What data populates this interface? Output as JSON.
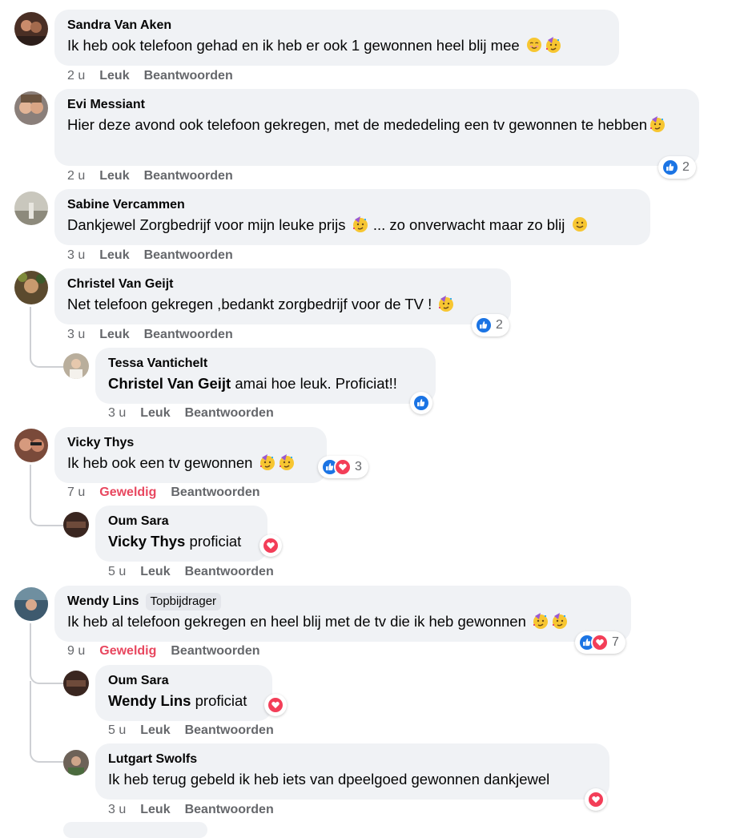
{
  "comments": [
    {
      "name": "Sandra Van Aken",
      "text": "Ik heb ook telefoon gehad en ik heb er ook 1 gewonnen heel blij mee",
      "time": "2 u",
      "action": "Leuk",
      "reply": "Beantwoorden",
      "avatar_color": "#5a3b2e"
    },
    {
      "name": "Evi Messiant",
      "text": "Hier deze avond ook telefoon gekregen, met de mededeling een tv gewonnen te hebben",
      "time": "2 u",
      "action": "Leuk",
      "reply": "Beantwoorden",
      "reaction_count": "2",
      "avatar_color": "#8a7f7a"
    },
    {
      "name": "Sabine Vercammen",
      "text": "Dankjewel Zorgbedrijf voor mijn leuke prijs",
      "text2": "... zo onverwacht maar zo blij",
      "time": "3 u",
      "action": "Leuk",
      "reply": "Beantwoorden",
      "avatar_color": "#b8b4a6"
    },
    {
      "name": "Christel Van Geijt",
      "text": "Net telefoon gekregen ,bedankt zorgbedrijf voor de TV !",
      "time": "3 u",
      "action": "Leuk",
      "reply": "Beantwoorden",
      "reaction_count": "2",
      "avatar_color": "#6b5a3a"
    },
    {
      "name": "Tessa Vantichelt",
      "mention": "Christel Van Geijt",
      "text": "amai hoe leuk. Proficiat!!",
      "time": "3 u",
      "action": "Leuk",
      "reply": "Beantwoorden",
      "avatar_color": "#a89a8c"
    },
    {
      "name": "Vicky Thys",
      "text": "Ik heb ook een tv gewonnen",
      "time": "7 u",
      "action": "Geweldig",
      "reply": "Beantwoorden",
      "reaction_count": "3",
      "avatar_color": "#7a4a3a"
    },
    {
      "name": "Oum Sara",
      "mention": "Vicky Thys",
      "text": "proficiat",
      "time": "5 u",
      "action": "Leuk",
      "reply": "Beantwoorden",
      "avatar_color": "#4a3025"
    },
    {
      "name": "Wendy Lins",
      "badge": "Topbijdrager",
      "text": "Ik heb al telefoon gekregen en heel blij met de tv die ik heb gewonnen",
      "time": "9 u",
      "action": "Geweldig",
      "reply": "Beantwoorden",
      "reaction_count": "7",
      "avatar_color": "#3e5a6e"
    },
    {
      "name": "Oum Sara",
      "mention": "Wendy Lins",
      "text": "proficiat",
      "time": "5 u",
      "action": "Leuk",
      "reply": "Beantwoorden",
      "avatar_color": "#4a3025"
    },
    {
      "name": "Lutgart Swolfs",
      "text": "Ik heb terug gebeld ik heb iets van dpeelgoed gewonnen dankjewel",
      "time": "3 u",
      "action": "Leuk",
      "reply": "Beantwoorden",
      "avatar_color": "#6d6258"
    }
  ],
  "colors": {
    "like": "#1b74e4",
    "love": "#f33e58",
    "geweldig": "#e8475f",
    "bubble": "#f0f2f5",
    "meta": "#65676b"
  }
}
